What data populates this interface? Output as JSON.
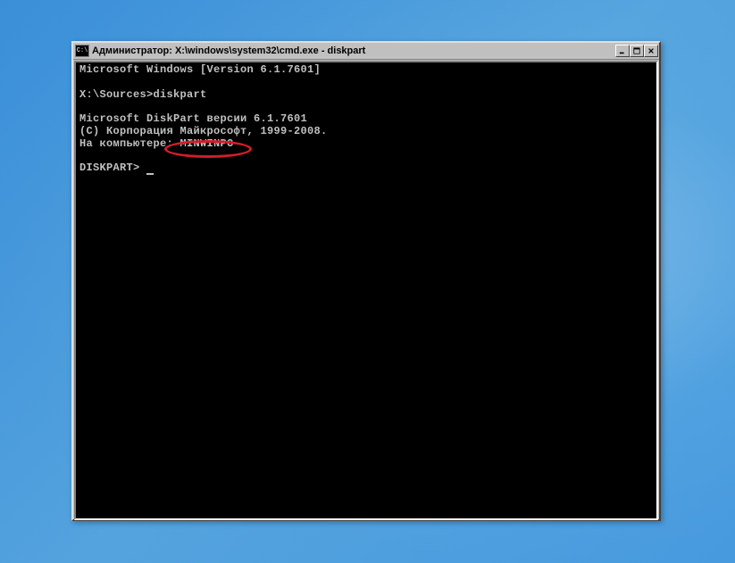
{
  "window": {
    "title": "Администратор: X:\\windows\\system32\\cmd.exe - diskpart",
    "icon_label": "C:\\"
  },
  "terminal": {
    "line1": "Microsoft Windows [Version 6.1.7601]",
    "prompt1_path": "X:\\Sources>",
    "prompt1_command": "diskpart",
    "output1": "Microsoft DiskPart версии 6.1.7601",
    "output2": "(C) Корпорация Майкрософт, 1999-2008.",
    "output3": "На компьютере: MINWINPC",
    "prompt2": "DISKPART> "
  },
  "controls": {
    "minimize": "minimize",
    "maximize": "maximize",
    "close": "close"
  }
}
